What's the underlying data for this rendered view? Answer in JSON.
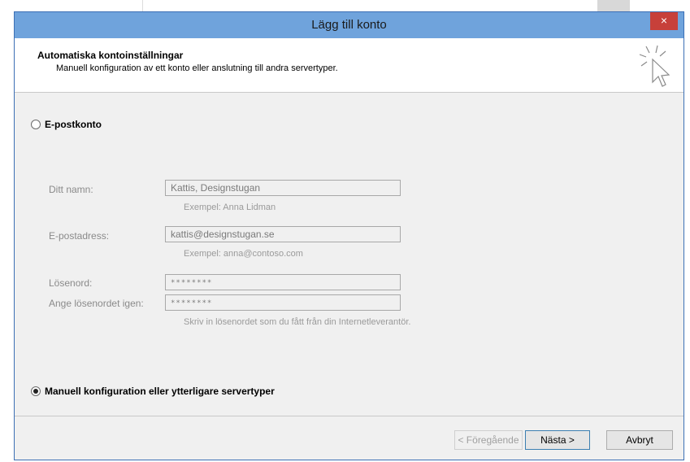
{
  "window": {
    "title": "Lägg till konto",
    "close_glyph": "×"
  },
  "header": {
    "title": "Automatiska kontoinställningar",
    "subtitle": "Manuell konfiguration av ett konto eller anslutning till andra servertyper."
  },
  "options": {
    "email_account": {
      "label": "E-postkonto",
      "selected": false
    },
    "manual_config": {
      "label": "Manuell konfiguration eller ytterligare servertyper",
      "selected": true
    }
  },
  "form": {
    "name": {
      "label": "Ditt namn:",
      "value": "Kattis, Designstugan",
      "hint": "Exempel: Anna Lidman"
    },
    "email": {
      "label": "E-postadress:",
      "value": "kattis@designstugan.se",
      "hint": "Exempel: anna@contoso.com"
    },
    "password": {
      "label": "Lösenord:",
      "value": "********"
    },
    "password_repeat": {
      "label": "Ange lösenordet igen:",
      "value": "********"
    },
    "password_hint": "Skriv in lösenordet som du fått från din Internetleverantör."
  },
  "buttons": {
    "back": "< Föregående",
    "next": "Nästa >",
    "cancel": "Avbryt"
  }
}
